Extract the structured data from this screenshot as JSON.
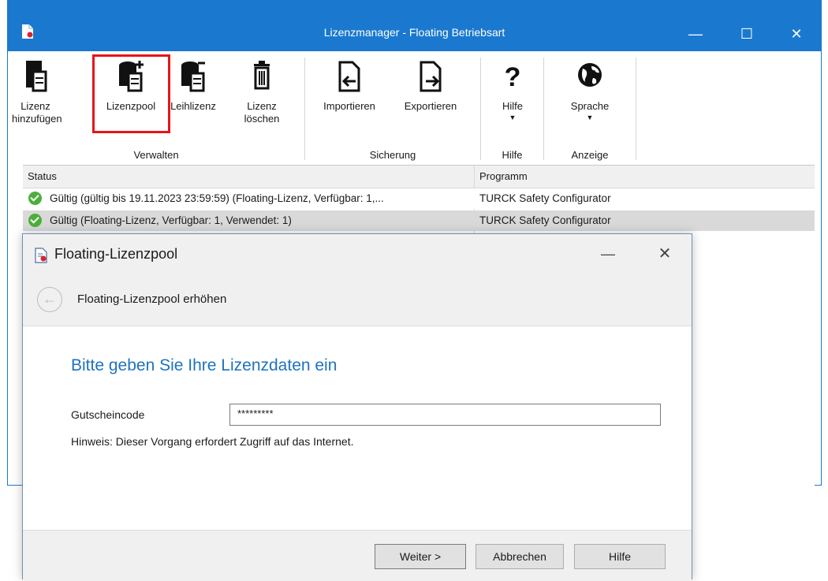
{
  "window": {
    "title": "Lizenzmanager - Floating Betriebsart",
    "accent": "#1a79cf"
  },
  "ribbon": {
    "buttons": [
      {
        "label": "Lizenz hinzufügen"
      },
      {
        "label": "Lizenzpool"
      },
      {
        "label": "Leihlizenz"
      },
      {
        "label": "Lizenz löschen"
      },
      {
        "label": "Importieren"
      },
      {
        "label": "Exportieren"
      },
      {
        "label": "Hilfe"
      },
      {
        "label": "Sprache"
      }
    ],
    "groups": [
      "Verwalten",
      "Sicherung",
      "Hilfe",
      "Anzeige"
    ],
    "highlight_color": "#e8141a"
  },
  "table": {
    "columns": [
      "Status",
      "Programm"
    ],
    "rows": [
      {
        "status": "Gültig (gültig bis 19.11.2023 23:59:59) (Floating-Lizenz, Verfügbar: 1,...",
        "program": "TURCK Safety Configurator"
      },
      {
        "status": "Gültig (Floating-Lizenz, Verfügbar: 1, Verwendet: 1)",
        "program": "TURCK Safety Configurator"
      }
    ]
  },
  "dialog": {
    "title": "Floating-Lizenzpool",
    "step_title": "Floating-Lizenzpool erhöhen",
    "heading": "Bitte geben Sie Ihre Lizenzdaten ein",
    "field_label": "Gutscheincode",
    "field_value": "*********",
    "hint": "Hinweis: Dieser Vorgang erfordert Zugriff auf das Internet.",
    "buttons": {
      "next": "Weiter >",
      "cancel": "Abbrechen",
      "help": "Hilfe"
    }
  }
}
